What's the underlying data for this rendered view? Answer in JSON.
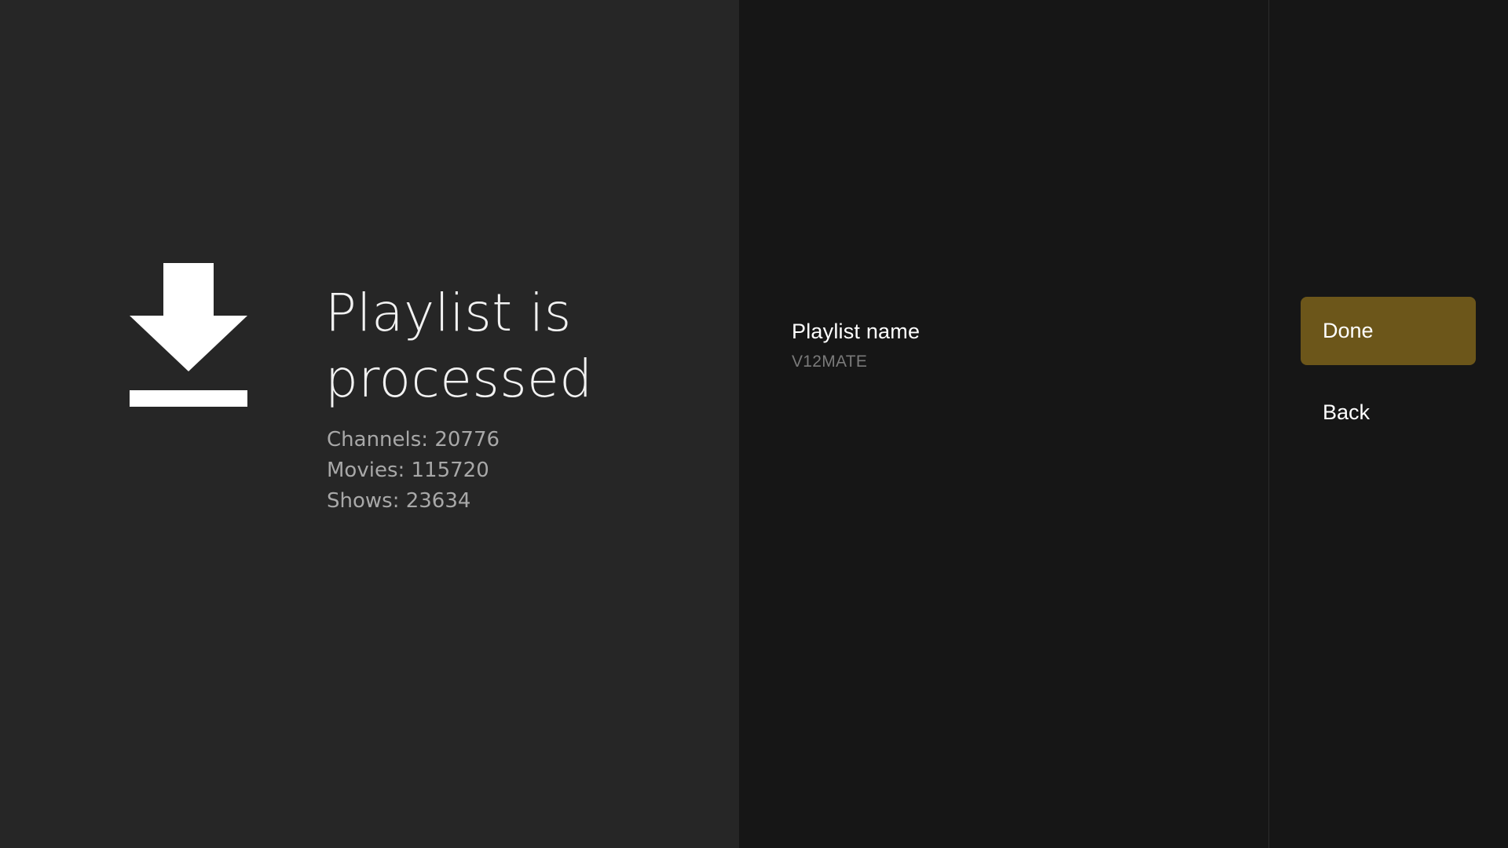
{
  "status": {
    "icon": "download-icon",
    "title": "Playlist is\nprocessed",
    "stats": [
      "Channels: 20776",
      "Movies: 115720",
      "Shows: 23634"
    ]
  },
  "playlist": {
    "name_label": "Playlist name",
    "name_value": "V12MATE"
  },
  "actions": {
    "done_label": "Done",
    "back_label": "Back"
  },
  "colors": {
    "left_background": "#262626",
    "panel_background": "#161616",
    "focused_accent": "#6c561a",
    "muted_text": "#a8a8a8"
  }
}
